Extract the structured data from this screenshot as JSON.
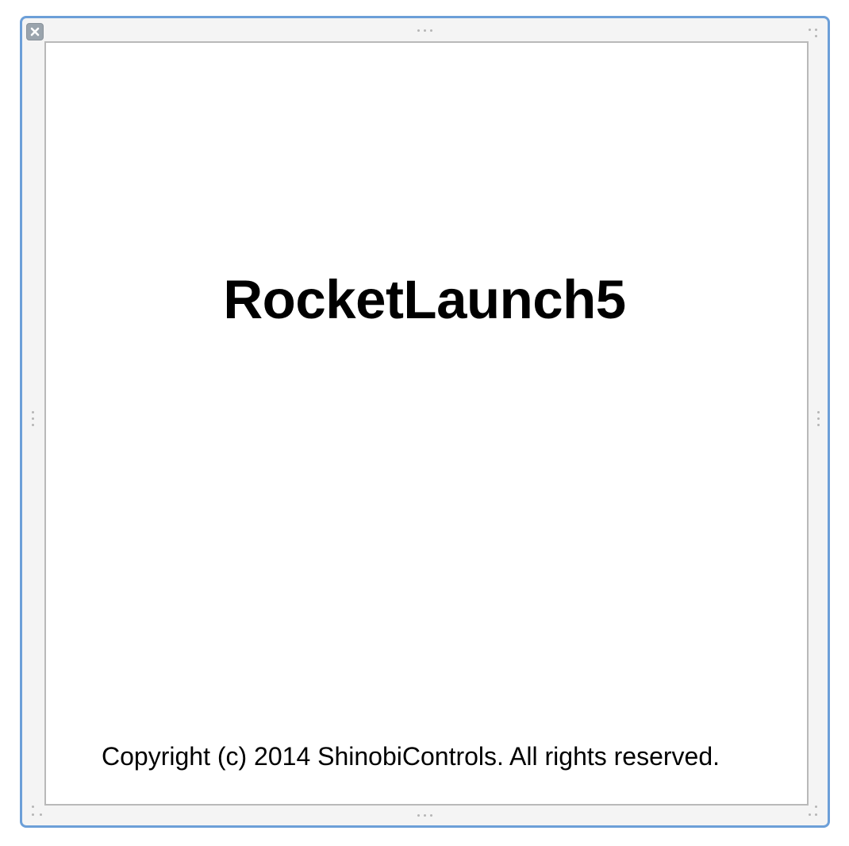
{
  "window": {
    "close_icon": "close-icon",
    "frame_color": "#6c9fd8"
  },
  "launch_screen": {
    "title": "RocketLaunch5",
    "copyright": "Copyright (c) 2014 ShinobiControls. All rights reserved."
  }
}
